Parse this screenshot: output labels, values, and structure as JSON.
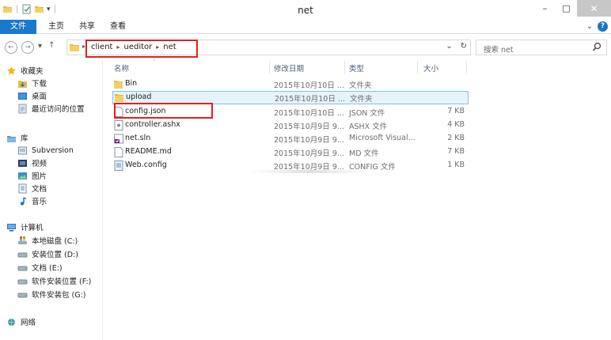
{
  "window": {
    "title": "net"
  },
  "caption": {
    "minimize": "–",
    "maximize": "□",
    "close": "✕"
  },
  "ribbon": {
    "tabs": [
      "文件",
      "主页",
      "共享",
      "查看"
    ],
    "collapse_icon": "chevron-down",
    "help_label": "?"
  },
  "address": {
    "crumbs": [
      "client",
      "ueditor",
      "net"
    ],
    "dropdown": "⌄",
    "refresh": "↻"
  },
  "search": {
    "placeholder": "搜索 net"
  },
  "navpane": {
    "favorites": {
      "title": "收藏夹",
      "items": [
        "下载",
        "桌面",
        "最近访问的位置"
      ]
    },
    "libraries": {
      "title": "库",
      "items": [
        "Subversion",
        "视频",
        "图片",
        "文档",
        "音乐"
      ]
    },
    "computer": {
      "title": "计算机",
      "items": [
        "本地磁盘 (C:)",
        "安装位置 (D:)",
        "文档 (E:)",
        "软件安装位置 (F:)",
        "软件安装包 (G:)"
      ]
    },
    "network": {
      "title": "网络"
    }
  },
  "columns": [
    "名称",
    "修改日期",
    "类型",
    "大小"
  ],
  "files": [
    {
      "name": "Bin",
      "date": "2015年10月10日 ...",
      "type": "文件夹",
      "size": "",
      "icon": "folder-icon"
    },
    {
      "name": "upload",
      "date": "2015年10月10日 ...",
      "type": "文件夹",
      "size": "",
      "icon": "folder-icon"
    },
    {
      "name": "config.json",
      "date": "2015年10月10日 ...",
      "type": "JSON 文件",
      "size": "7 KB",
      "icon": "document-icon"
    },
    {
      "name": "controller.ashx",
      "date": "2015年10月9日 9...",
      "type": "ASHX 文件",
      "size": "4 KB",
      "icon": "ashx-file-icon"
    },
    {
      "name": "net.sln",
      "date": "2015年10月9日 9...",
      "type": "Microsoft Visual...",
      "size": "2 KB",
      "icon": "visual-studio-icon"
    },
    {
      "name": "README.md",
      "date": "2015年10月9日 9...",
      "type": "MD 文件",
      "size": "7 KB",
      "icon": "document-icon"
    },
    {
      "name": "Web.config",
      "date": "2015年10月9日 9...",
      "type": "CONFIG 文件",
      "size": "1 KB",
      "icon": "config-file-icon"
    }
  ],
  "colors": {
    "accent": "#1979ca",
    "highlight": "#e0211b",
    "selection": "#e5f3fb",
    "folder": "#e8b947"
  }
}
